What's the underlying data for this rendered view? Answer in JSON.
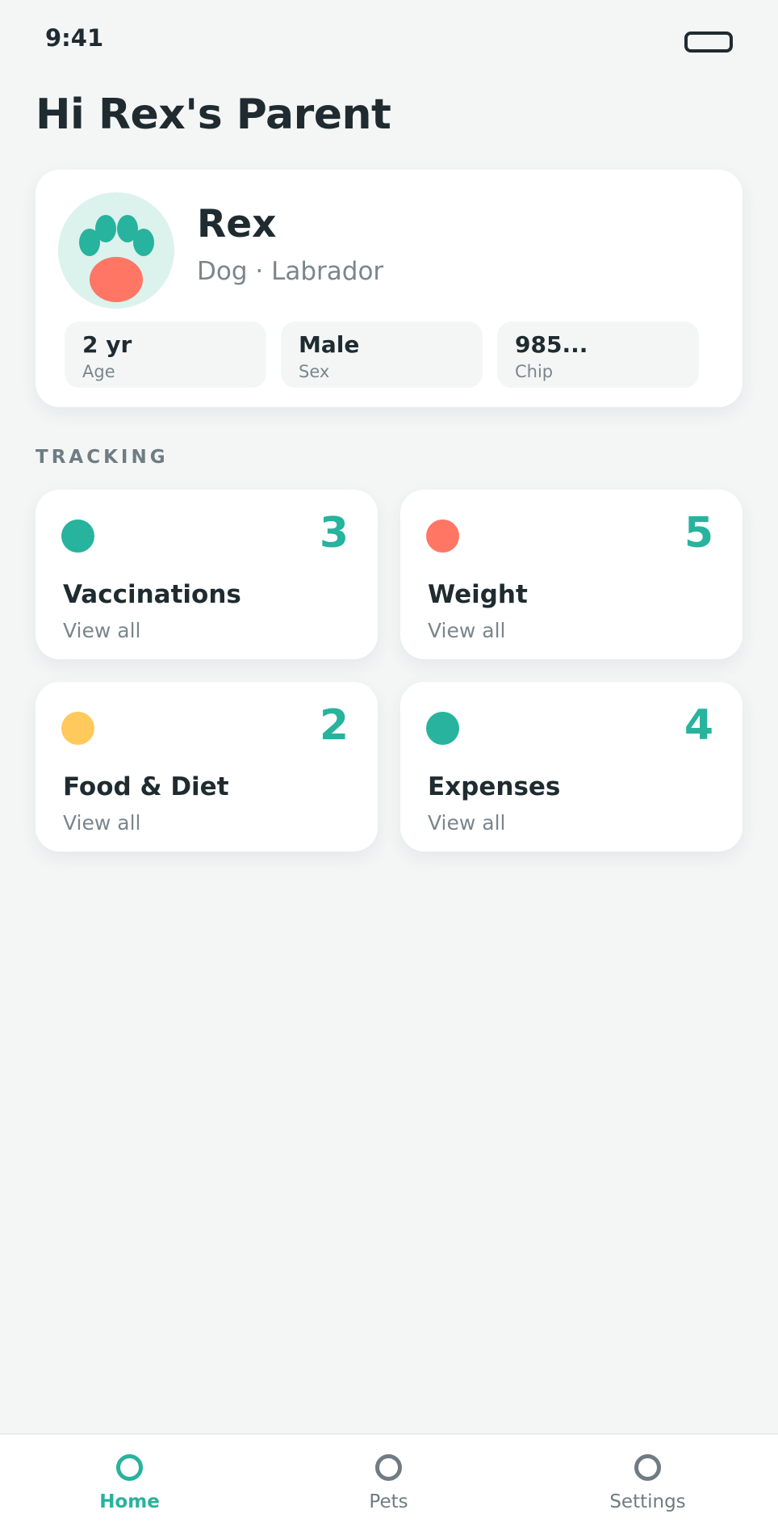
{
  "status_bar": {
    "time": "9:41"
  },
  "greeting": "Hi Rex's Parent",
  "pet": {
    "name": "Rex",
    "breed_line": "Dog · Labrador",
    "stats": [
      {
        "value": "2 yr",
        "label": "Age"
      },
      {
        "value": "Male",
        "label": "Sex"
      },
      {
        "value": "985...",
        "label": "Chip"
      }
    ]
  },
  "tracking": {
    "title": "TRACKING",
    "tiles": [
      {
        "title": "Vaccinations",
        "count": "3",
        "link": "View all",
        "color": "#27b39d"
      },
      {
        "title": "Weight",
        "count": "5",
        "link": "View all",
        "color": "#ff7664"
      },
      {
        "title": "Food & Diet",
        "count": "2",
        "link": "View all",
        "color": "#ffc95c"
      },
      {
        "title": "Expenses",
        "count": "4",
        "link": "View all",
        "color": "#27b39d"
      }
    ]
  },
  "nav": {
    "items": [
      {
        "label": "Home",
        "active": true
      },
      {
        "label": "Pets",
        "active": false
      },
      {
        "label": "Settings",
        "active": false
      }
    ]
  },
  "colors": {
    "accent": "#27b39d",
    "coral": "#ff7664",
    "amber": "#ffc95c",
    "avatar_bg": "#dcf2ed"
  }
}
